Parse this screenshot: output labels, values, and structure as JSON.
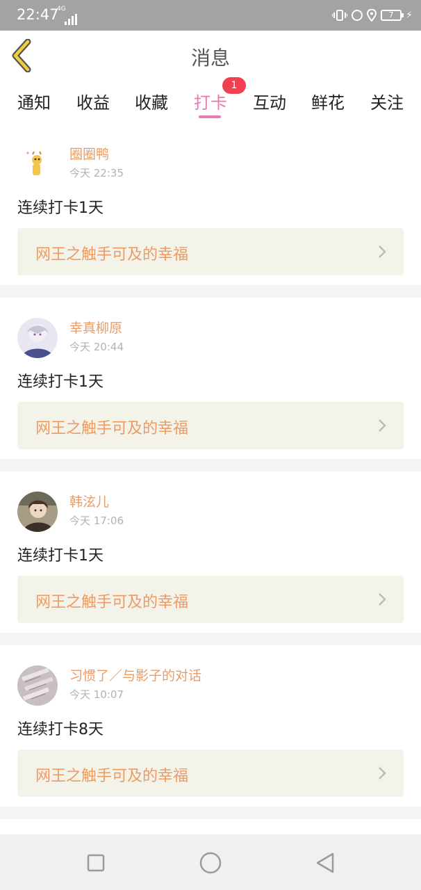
{
  "status_bar": {
    "time": "22:47",
    "network": "4G",
    "battery": "7"
  },
  "header": {
    "title": "消息"
  },
  "tabs": [
    {
      "label": "通知"
    },
    {
      "label": "收益"
    },
    {
      "label": "收藏"
    },
    {
      "label": "打卡",
      "badge": "1",
      "active": true
    },
    {
      "label": "互动"
    },
    {
      "label": "鲜花"
    },
    {
      "label": "关注"
    }
  ],
  "messages": [
    {
      "name": "圈圈鸭",
      "time": "今天 22:35",
      "text": "连续打卡1天",
      "link": "网王之触手可及的幸福"
    },
    {
      "name": "幸真柳原",
      "time": "今天 20:44",
      "text": "连续打卡1天",
      "link": "网王之触手可及的幸福"
    },
    {
      "name": "韩泫儿",
      "time": "今天 17:06",
      "text": "连续打卡1天",
      "link": "网王之触手可及的幸福"
    },
    {
      "name": "习惯了／与影子的对话",
      "time": "今天 10:07",
      "text": "连续打卡8天",
      "link": "网王之触手可及的幸福"
    }
  ],
  "colors": {
    "accent_pink": "#e67ab0",
    "name_orange": "#ec9b63",
    "badge_red": "#f14052",
    "back_arrow": "#f1ce3d"
  },
  "icons": {
    "back": "chevron-left-icon",
    "link": "chevron-right-icon",
    "nav_recent": "square-icon",
    "nav_home": "circle-icon",
    "nav_back": "triangle-left-icon"
  }
}
